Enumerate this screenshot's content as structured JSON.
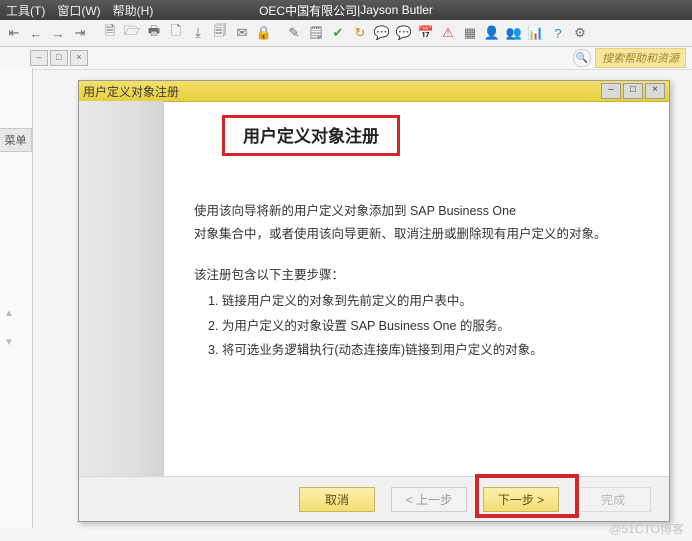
{
  "menubar": {
    "items": [
      "工具(T)",
      "窗口(W)",
      "帮助(H)"
    ],
    "title_company": "OEC中国有限公司",
    "title_sep": " | ",
    "title_user": "Jayson Butler"
  },
  "toolbar_icons": [
    {
      "name": "nav-first-icon",
      "glyph": "⇤"
    },
    {
      "name": "nav-prev-icon",
      "glyph": "←"
    },
    {
      "name": "nav-next-icon",
      "glyph": "→"
    },
    {
      "name": "nav-last-icon",
      "glyph": "⇥"
    },
    {
      "name": "sep",
      "glyph": ""
    },
    {
      "name": "doc-new-icon",
      "glyph": "🗎"
    },
    {
      "name": "doc-open-icon",
      "glyph": "🗁"
    },
    {
      "name": "print-icon",
      "glyph": "🖶"
    },
    {
      "name": "preview-icon",
      "glyph": "🗋"
    },
    {
      "name": "export-icon",
      "glyph": "⤓"
    },
    {
      "name": "excel-icon",
      "glyph": "🗐"
    },
    {
      "name": "mail-icon",
      "glyph": "✉"
    },
    {
      "name": "lock-icon",
      "glyph": "🔒"
    },
    {
      "name": "sep",
      "glyph": ""
    },
    {
      "name": "edit-icon",
      "glyph": "✎"
    },
    {
      "name": "note-icon",
      "glyph": "🗒"
    },
    {
      "name": "check-icon",
      "glyph": "✔",
      "cls": "green"
    },
    {
      "name": "refresh-icon",
      "glyph": "↻",
      "cls": "orange"
    },
    {
      "name": "chat-icon",
      "glyph": "💬",
      "cls": "blue"
    },
    {
      "name": "chat2-icon",
      "glyph": "💬"
    },
    {
      "name": "calendar-icon",
      "glyph": "📅",
      "cls": "green"
    },
    {
      "name": "alert-icon",
      "glyph": "⚠",
      "cls": "red"
    },
    {
      "name": "grid-icon",
      "glyph": "▦"
    },
    {
      "name": "user-icon",
      "glyph": "👤"
    },
    {
      "name": "users-icon",
      "glyph": "👥"
    },
    {
      "name": "chart-icon",
      "glyph": "📊",
      "cls": "orange"
    },
    {
      "name": "help-icon",
      "glyph": "?",
      "cls": "blue"
    },
    {
      "name": "gear-icon",
      "glyph": "⚙"
    }
  ],
  "search": {
    "placeholder": "搜索帮助和资源"
  },
  "sidebar": {
    "tab_label": "菜单"
  },
  "wizard": {
    "window_title": "用户定义对象注册",
    "heading": "用户定义对象注册",
    "paragraph": "使用该向导将新的用户定义对象添加到 SAP Business One\n对象集合中，或者使用该向导更新、取消注册或删除现有用户定义的对象。",
    "steps_intro": "该注册包含以下主要步骤：",
    "steps": [
      "1. 链接用户定义的对象到先前定义的用户表中。",
      "2. 为用户定义的对象设置 SAP Business One 的服务。",
      "3. 将可选业务逻辑执行(动态连接库)链接到用户定义的对象。"
    ],
    "buttons": {
      "cancel": "取消",
      "back": "< 上一步",
      "next": "下一步 >",
      "finish": "完成"
    }
  },
  "watermark": "@51CTO博客"
}
